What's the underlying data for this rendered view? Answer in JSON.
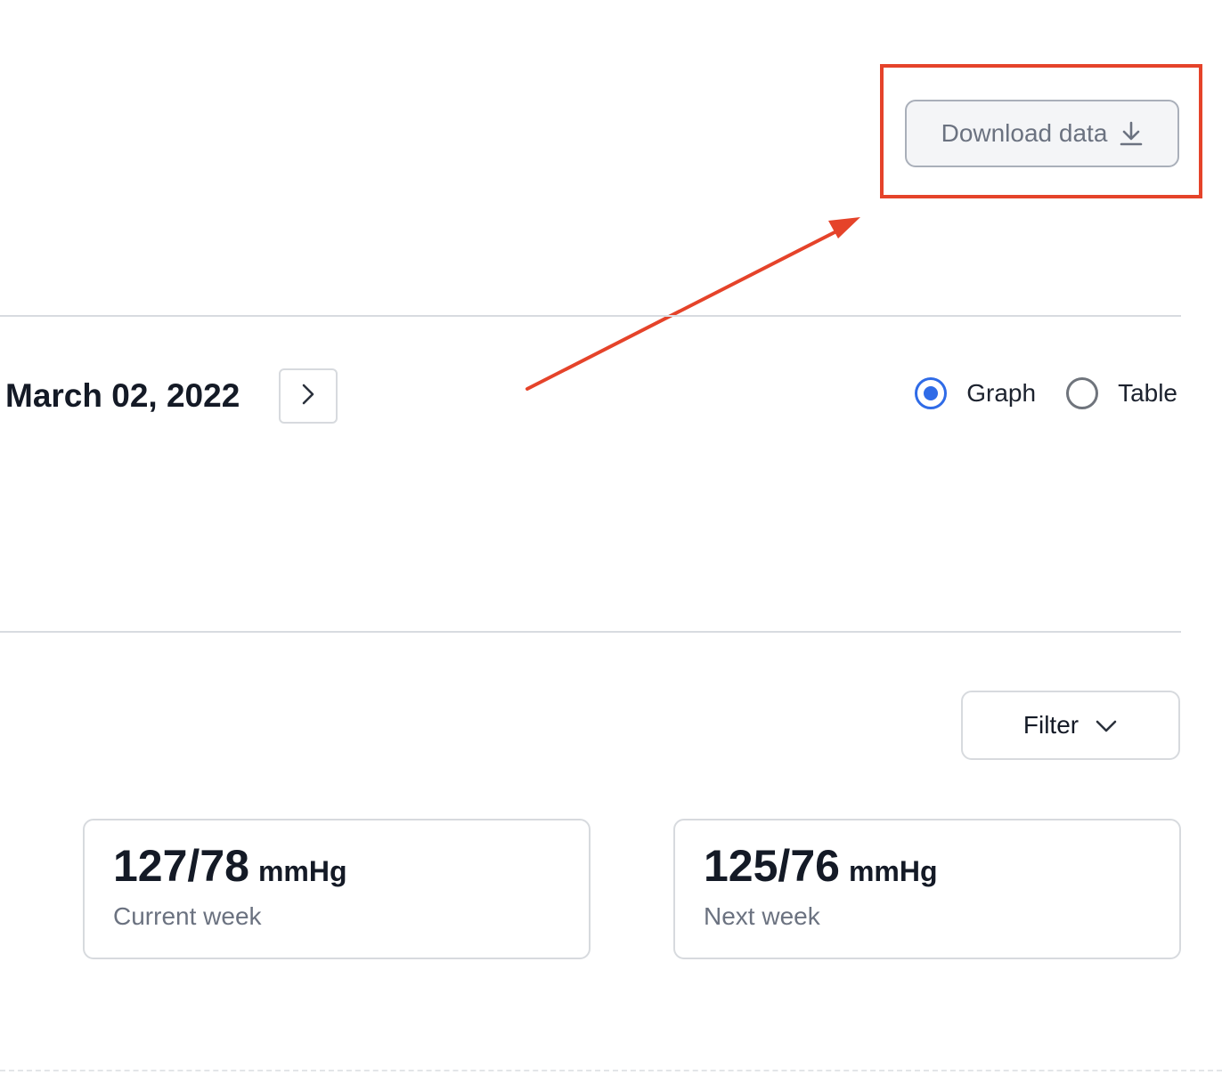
{
  "toolbar": {
    "download_label": "Download data",
    "download_icon": "download-icon"
  },
  "annotation": {
    "color": "#e5432a"
  },
  "date_nav": {
    "current_date": "March 02, 2022",
    "next_icon": "chevron-right-icon"
  },
  "view_toggle": {
    "options": [
      {
        "label": "Graph",
        "selected": true
      },
      {
        "label": "Table",
        "selected": false
      }
    ],
    "accent_color": "#2f6be7"
  },
  "filter": {
    "label": "Filter",
    "icon": "chevron-down-icon"
  },
  "stats": [
    {
      "value": "127/78",
      "unit": "mmHg",
      "label": "Current week"
    },
    {
      "value": "125/76",
      "unit": "mmHg",
      "label": "Next week"
    }
  ]
}
